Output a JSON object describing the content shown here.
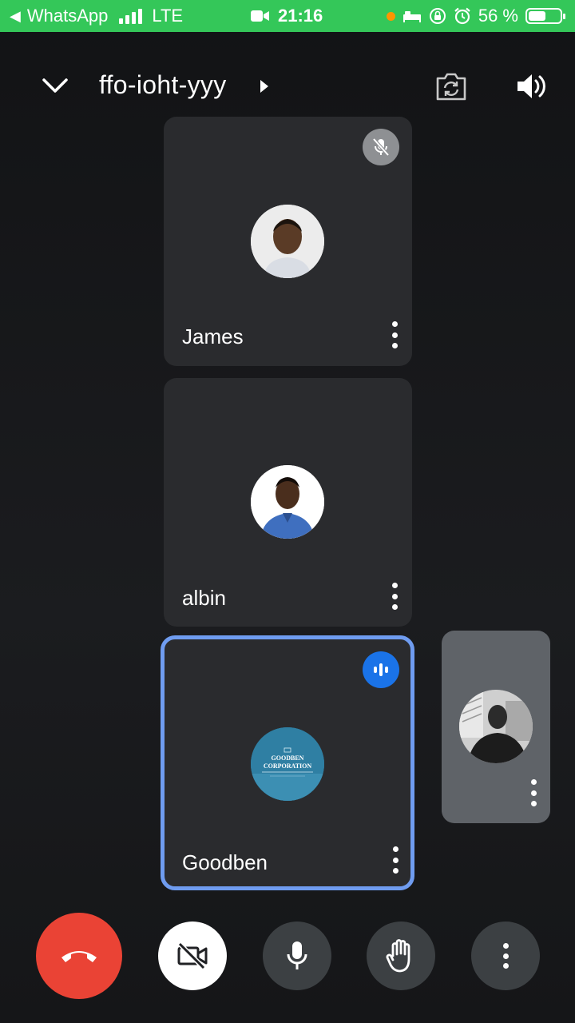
{
  "status_bar": {
    "back_app": "WhatsApp",
    "network": "LTE",
    "time": "21:16",
    "battery_text": "56 %",
    "battery_level": 0.56,
    "signal_bars": 4
  },
  "header": {
    "meeting_code": "ffo-ioht-yyy",
    "icons": [
      "chevron-down-icon",
      "caret-right-icon",
      "switch-camera-icon",
      "speaker-icon"
    ]
  },
  "participants": [
    {
      "name": "James",
      "muted": true,
      "speaking": false
    },
    {
      "name": "albin",
      "muted": false,
      "speaking": false
    },
    {
      "name": "Goodben",
      "muted": false,
      "speaking": true,
      "avatar_text": [
        "GOODBEN",
        "CORPORATION"
      ]
    }
  ],
  "self_view": {
    "label": ""
  },
  "controls": {
    "icons": [
      "end-call-icon",
      "camera-off-icon",
      "microphone-icon",
      "raise-hand-icon",
      "more-vert-icon"
    ]
  },
  "colors": {
    "status_bar": "#34c759",
    "tile_bg": "#2a2b2e",
    "active_border": "#6f9cf0",
    "speaking_badge": "#1a73e8",
    "end_call": "#ea4335",
    "control_bg": "#3c4043"
  }
}
